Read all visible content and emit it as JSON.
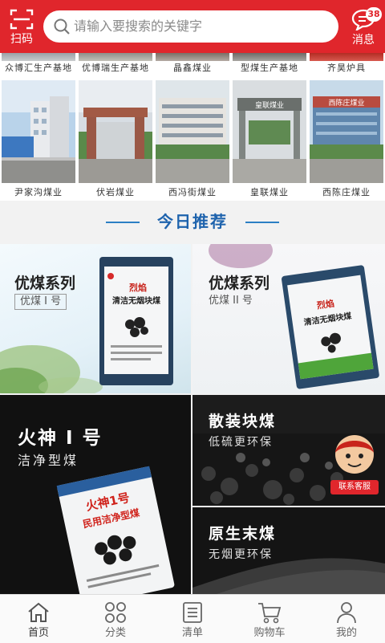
{
  "header": {
    "scan_label": "扫码",
    "search_placeholder": "请输入要搜索的关键字",
    "message_label": "消息",
    "message_badge": "38",
    "accent_color": "#e0262c"
  },
  "top_strip": [
    "众博汇生产基地",
    "优博瑞生产基地",
    "晶鑫煤业",
    "型煤生产基地",
    "齐昊炉具"
  ],
  "suppliers": [
    {
      "name": "尹家沟煤业",
      "sign": ""
    },
    {
      "name": "伏岩煤业",
      "sign": ""
    },
    {
      "name": "西冯街煤业",
      "sign": ""
    },
    {
      "name": "皇联煤业",
      "sign": "皇联煤业"
    },
    {
      "name": "西陈庄煤业",
      "sign": "西陈庄煤业"
    }
  ],
  "recommend": {
    "title": "今日推荐"
  },
  "products": [
    {
      "title": "优煤系列",
      "subtitle": "优煤 I 号",
      "bag_brand": "烈焰",
      "bag_name": "清洁无烟块煤"
    },
    {
      "title": "优煤系列",
      "subtitle": "优煤 II 号",
      "bag_brand": "烈焰",
      "bag_name": "清洁无烟块煤"
    },
    {
      "title": "火神 I 号",
      "subtitle": "洁净型煤",
      "bag_brand": "火神1号",
      "bag_name": "民用洁净型煤"
    },
    {
      "title": "散装块煤",
      "subtitle": "低硫更环保",
      "service_label": "联系客服"
    },
    {
      "title": "原生末煤",
      "subtitle": "无烟更环保"
    }
  ],
  "tabbar": {
    "items": [
      {
        "label": "首页",
        "icon": "home-icon"
      },
      {
        "label": "分类",
        "icon": "category-icon"
      },
      {
        "label": "清单",
        "icon": "list-icon"
      },
      {
        "label": "购物车",
        "icon": "cart-icon"
      },
      {
        "label": "我的",
        "icon": "user-icon"
      }
    ]
  }
}
